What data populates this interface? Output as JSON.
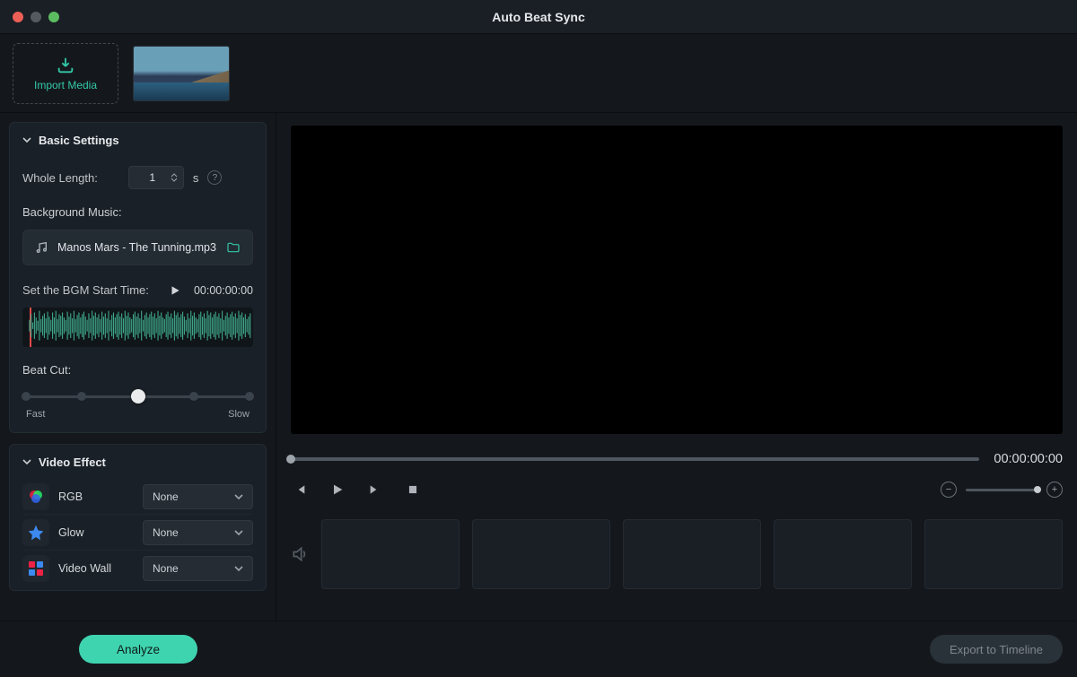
{
  "window": {
    "title": "Auto Beat Sync"
  },
  "import": {
    "label": "Import Media"
  },
  "basic": {
    "header": "Basic Settings",
    "whole_length_label": "Whole Length:",
    "whole_length_value": "1",
    "whole_length_unit": "s",
    "bg_music_label": "Background Music:",
    "bg_music_file": "Manos Mars - The Tunning.mp3",
    "bgm_start_label": "Set the BGM Start Time:",
    "bgm_start_time": "00:00:00:00",
    "beat_cut_label": "Beat Cut:",
    "beat_cut_fast": "Fast",
    "beat_cut_slow": "Slow"
  },
  "fx": {
    "header": "Video Effect",
    "rows": [
      {
        "name": "RGB",
        "value": "None"
      },
      {
        "name": "Glow",
        "value": "None"
      },
      {
        "name": "Video Wall",
        "value": "None"
      }
    ]
  },
  "preview": {
    "timecode": "00:00:00:00"
  },
  "actions": {
    "analyze": "Analyze",
    "export": "Export to Timeline"
  },
  "colors": {
    "accent": "#3fd4b0"
  }
}
